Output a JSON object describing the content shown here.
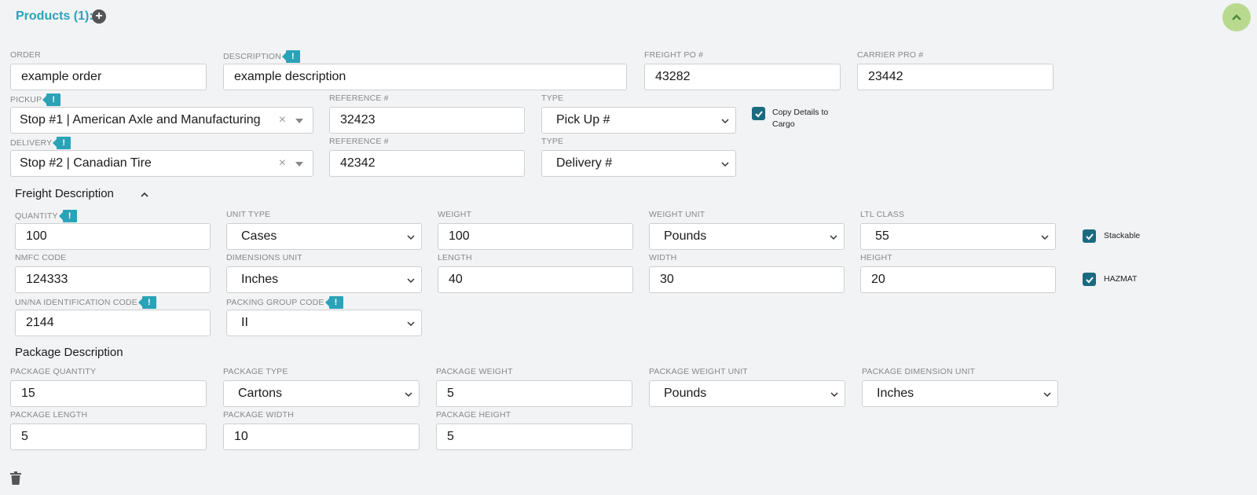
{
  "header": {
    "title": "Products (1):"
  },
  "order": {
    "order_label": "ORDER",
    "order_value": "example order",
    "description_label": "DESCRIPTION",
    "description_value": "example description",
    "freight_po_label": "FREIGHT PO #",
    "freight_po_value": "43282",
    "carrier_pro_label": "CARRIER PRO #",
    "carrier_pro_value": "23442"
  },
  "pickup": {
    "label": "PICKUP",
    "value": "Stop #1 | American Axle and Manufacturing",
    "ref_label": "REFERENCE #",
    "ref_value": "32423",
    "type_label": "TYPE",
    "type_value": "Pick Up #",
    "copy_label_line1": "Copy Details to",
    "copy_label_line2": "Cargo"
  },
  "delivery": {
    "label": "DELIVERY",
    "value": "Stop #2 | Canadian Tire",
    "ref_label": "REFERENCE #",
    "ref_value": "42342",
    "type_label": "TYPE",
    "type_value": "Delivery #"
  },
  "freight": {
    "section_title": "Freight Description",
    "quantity_label": "QUANTITY",
    "quantity_value": "100",
    "unit_type_label": "UNIT TYPE",
    "unit_type_value": "Cases",
    "weight_label": "WEIGHT",
    "weight_value": "100",
    "weight_unit_label": "WEIGHT UNIT",
    "weight_unit_value": "Pounds",
    "ltl_class_label": "LTL CLASS",
    "ltl_class_value": "55",
    "stackable_label": "Stackable",
    "nmfc_label": "NMFC CODE",
    "nmfc_value": "124333",
    "dim_unit_label": "DIMENSIONS UNIT",
    "dim_unit_value": "Inches",
    "length_label": "LENGTH",
    "length_value": "40",
    "width_label": "WIDTH",
    "width_value": "30",
    "height_label": "HEIGHT",
    "height_value": "20",
    "hazmat_label": "HAZMAT",
    "un_label": "UN/NA IDENTIFICATION CODE",
    "un_value": "2144",
    "packing_group_label": "PACKING GROUP CODE",
    "packing_group_value": "II"
  },
  "package": {
    "section_title": "Package Description",
    "qty_label": "PACKAGE QUANTITY",
    "qty_value": "15",
    "type_label": "PACKAGE TYPE",
    "type_value": "Cartons",
    "weight_label": "PACKAGE WEIGHT",
    "weight_value": "5",
    "weight_unit_label": "PACKAGE WEIGHT UNIT",
    "weight_unit_value": "Pounds",
    "dim_unit_label": "PACKAGE DIMENSION UNIT",
    "dim_unit_value": "Inches",
    "length_label": "PACKAGE LENGTH",
    "length_value": "5",
    "width_label": "PACKAGE WIDTH",
    "width_value": "10",
    "height_label": "PACKAGE HEIGHT",
    "height_value": "5"
  },
  "icons": {
    "add": "plus-circle-icon",
    "collapse": "chevron-up-icon",
    "alert": "exclamation-flag-icon",
    "trash": "trash-icon",
    "check": "check-icon",
    "select": "chevron-down-icon",
    "clear": "close-icon"
  },
  "colors": {
    "accent": "#2aa3b8",
    "checkbox": "#1a6a80",
    "collapse_bg": "#b9d98f"
  }
}
